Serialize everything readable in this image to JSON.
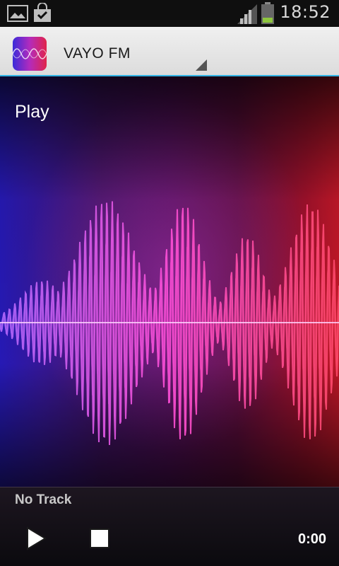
{
  "status_bar": {
    "time": "18:52",
    "icons": [
      "picture-icon",
      "shopping-bag-check-icon",
      "signal-icon",
      "battery-icon"
    ]
  },
  "action_bar": {
    "title": "VAYO FM",
    "icon": "app-logo-waveform"
  },
  "main": {
    "play_label": "Play"
  },
  "player": {
    "track_text": "No Track",
    "elapsed": "0:00",
    "controls": [
      "play-icon",
      "stop-icon"
    ]
  },
  "colors": {
    "accent_line": "#33b5e5",
    "wave_left": "#b368ff",
    "wave_mid": "#ff4fd8",
    "wave_right": "#ff4a6a"
  }
}
